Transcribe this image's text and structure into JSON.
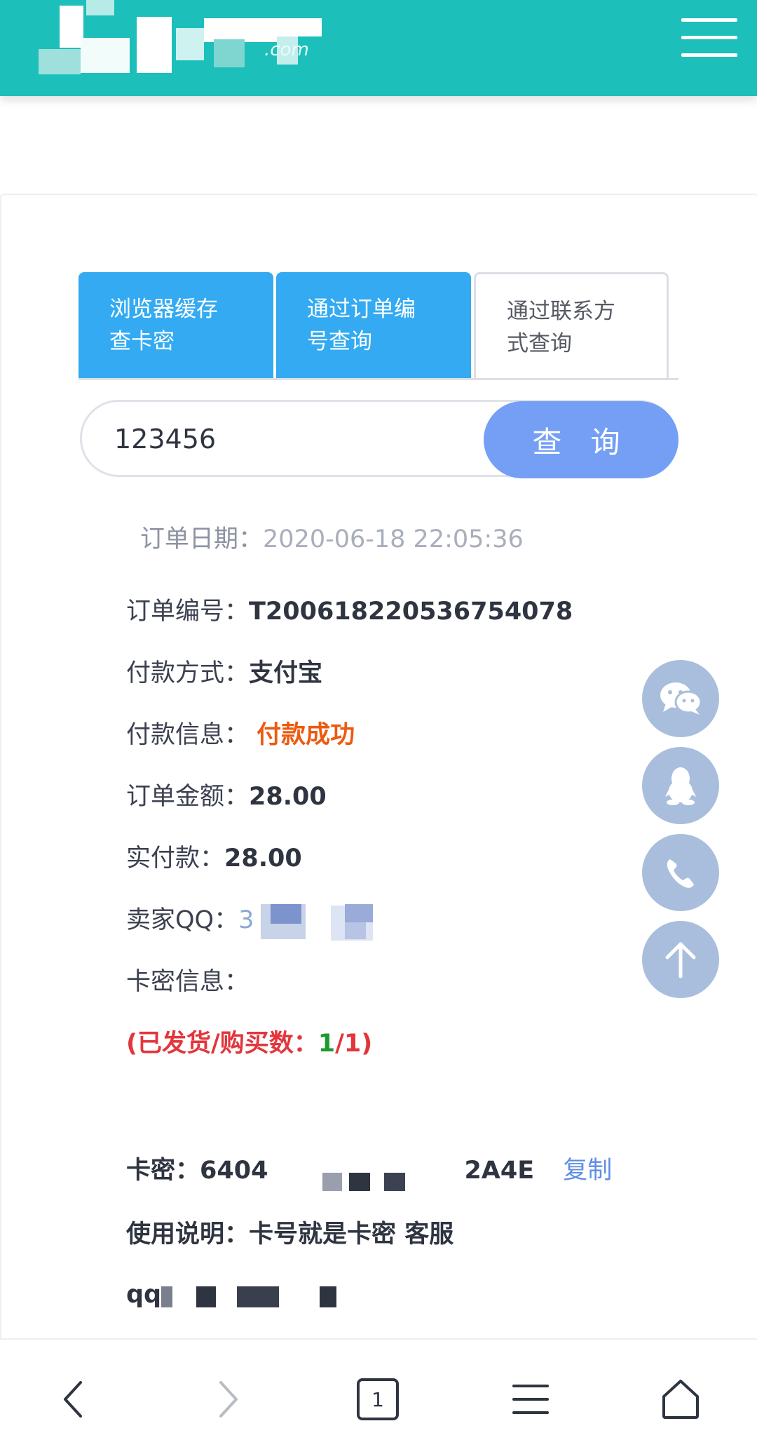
{
  "header": {
    "logo_text": ".com",
    "menu_icon": "hamburger-menu-icon"
  },
  "tabs": [
    {
      "line1": "浏览器缓存",
      "line2": "查卡密",
      "state": "active"
    },
    {
      "line1": "通过订单编",
      "line2": "号查询",
      "state": "active"
    },
    {
      "line1": "通过联系方",
      "line2": "式查询",
      "state": "inactive"
    }
  ],
  "search": {
    "value": "123456",
    "button_label": "查 询"
  },
  "order": {
    "date_label": "订单日期：",
    "date_value": "2020-06-18 22:05:36",
    "number_label": "订单编号：",
    "number_value": "T200618220536754078",
    "pay_method_label": "付款方式：",
    "pay_method_value": "支付宝",
    "pay_info_label": "付款信息：",
    "pay_info_value": "付款成功",
    "amount_label": "订单金额：",
    "amount_value": "28.00",
    "paid_label": "实付款：",
    "paid_value": "28.00",
    "seller_qq_label": "卖家QQ：",
    "seller_qq_visible": "3",
    "card_info_label": "卡密信息：",
    "shipped_prefix": "(已发货/购买数：",
    "shipped_count": "1",
    "shipped_suffix": "/1)",
    "card_key_label": "卡密：",
    "card_key_start": "6404",
    "card_key_end": "2A4E",
    "copy_label": "复制",
    "usage_label": "使用说明：",
    "usage_value": "卡号就是卡密 客服",
    "qq_prefix": "qq"
  },
  "floating_buttons": [
    "wechat-icon",
    "qq-penguin-icon",
    "phone-icon",
    "back-to-top-icon"
  ],
  "bottom_nav": {
    "tab_count": "1",
    "icons": [
      "back-icon",
      "forward-icon",
      "tabs-icon",
      "menu-icon",
      "home-icon"
    ]
  },
  "colors": {
    "header": "#1cbfb9",
    "tab_active": "#33aaf2",
    "search_button": "#759ff5",
    "success": "#ec5a10",
    "shipped": "#e2363b",
    "count_green": "#1d9a2e",
    "link": "#5f8ee6",
    "fab": "#a9bedc"
  }
}
